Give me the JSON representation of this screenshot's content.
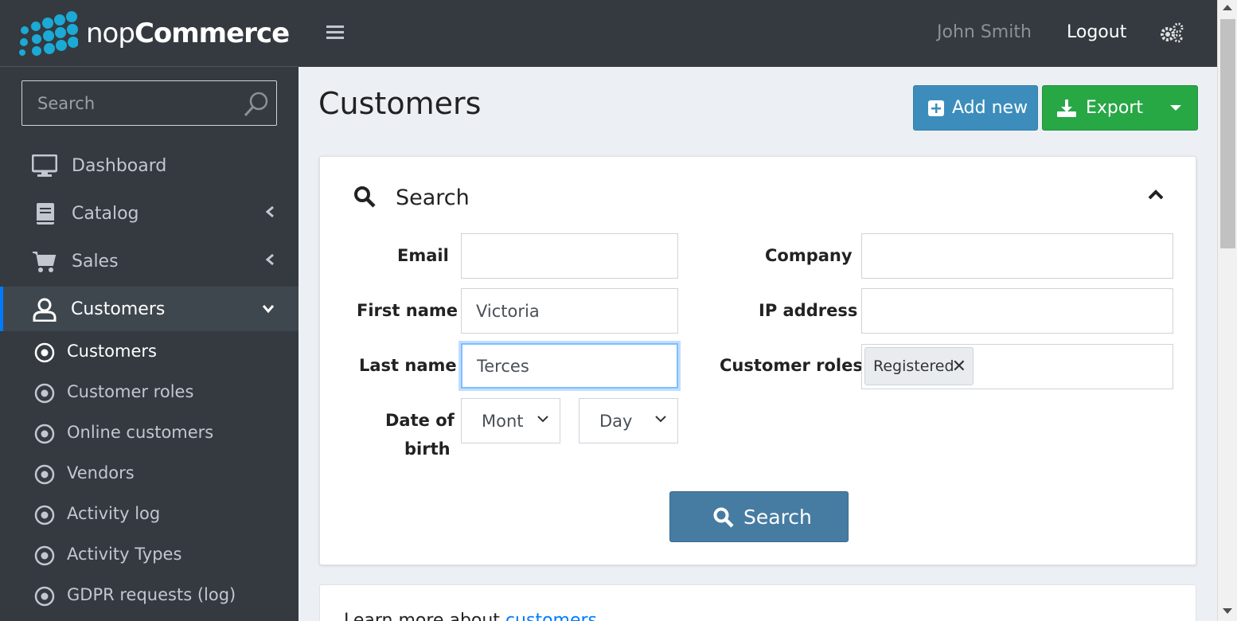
{
  "brand": {
    "name_light": "nop",
    "name_bold": "Commerce"
  },
  "sidebar": {
    "search_placeholder": "Search",
    "items": [
      {
        "label": "Dashboard",
        "icon": "monitor-icon"
      },
      {
        "label": "Catalog",
        "icon": "book-icon"
      },
      {
        "label": "Sales",
        "icon": "cart-icon"
      },
      {
        "label": "Customers",
        "icon": "user-icon"
      }
    ],
    "sub_items": [
      {
        "label": "Customers"
      },
      {
        "label": "Customer roles"
      },
      {
        "label": "Online customers"
      },
      {
        "label": "Vendors"
      },
      {
        "label": "Activity log"
      },
      {
        "label": "Activity Types"
      },
      {
        "label": "GDPR requests (log)"
      }
    ]
  },
  "topbar": {
    "user": "John Smith",
    "logout": "Logout"
  },
  "page": {
    "title": "Customers",
    "add_new": "Add new",
    "export": "Export"
  },
  "search_panel": {
    "title": "Search",
    "email_label": "Email",
    "email_value": "",
    "first_name_label": "First name",
    "first_name_value": "Victoria",
    "last_name_label": "Last name",
    "last_name_value": "Terces",
    "dob_label_1": "Date of",
    "dob_label_2": "birth",
    "month_value": "Mont",
    "day_value": "Day",
    "company_label": "Company",
    "company_value": "",
    "ip_label": "IP address",
    "ip_value": "",
    "roles_label": "Customer roles",
    "role_tag": "Registered",
    "search_button": "Search"
  },
  "footer_note": {
    "text": "Learn more about ",
    "link": "customers"
  },
  "colors": {
    "sidebar": "#343a40",
    "primary": "#3c8dbc",
    "success": "#28a745",
    "search_btn": "#467ca2"
  }
}
